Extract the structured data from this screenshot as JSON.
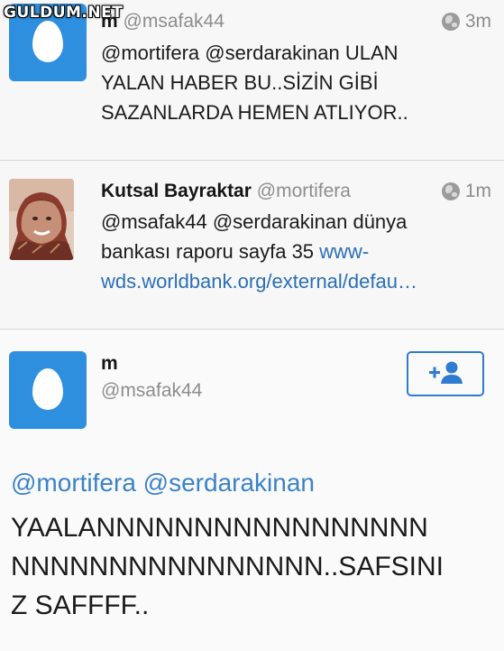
{
  "watermark": "GULDUM.NET",
  "tweets": [
    {
      "name": "m",
      "handle": "@msafak44",
      "time": "3m",
      "text_lines": [
        "@mortifera @serdarakinan ULAN",
        "YALAN HABER BU..SİZİN GİBİ",
        "SAZANLARDA HEMEN ATLIYOR.."
      ]
    },
    {
      "name": "Kutsal Bayraktar",
      "handle": "@mortifera",
      "time": "1m",
      "text_line1": "@msafak44 @serdarakinan dünya",
      "text_line2_plain": "bankası raporu sayfa 35 ",
      "text_line2_link": "www-",
      "text_line3_link": "wds.worldbank.org/external/defau…"
    }
  ],
  "detail": {
    "name": "m",
    "handle": "@msafak44",
    "follow_icon": "add-user-icon",
    "mentions": "@mortifera @serdarakinan",
    "text_lines": [
      "YAALANNNNNNNNNNNNNNNNN",
      "NNNNNNNNNNNNNNNN..SAFSINI",
      "Z SAFFFF.."
    ]
  },
  "colors": {
    "egg_avatar": "#2f8fdf",
    "link": "#2b6fb6",
    "follow_border": "#2f7bd0"
  }
}
